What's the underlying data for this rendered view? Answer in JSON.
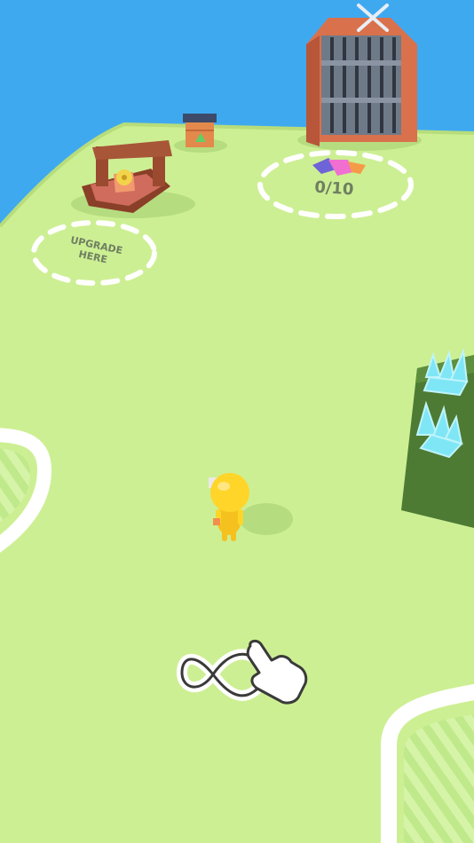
{
  "upgrade_zone": {
    "label_line1": "UPGRADE",
    "label_line2": "HERE"
  },
  "gate_zone": {
    "progress_text": "0/10",
    "collected": 0,
    "required": 10
  },
  "colors": {
    "sky": "#3fa9f0",
    "ground": "#cdef93",
    "ground_edge": "#b7dd7b",
    "player": "#ffd52a",
    "gate_wood": "#d9714c",
    "crystal": "#7fe6f6",
    "zone_dash": "#ffffff"
  },
  "icons": {
    "gem": "gem-icon",
    "tutorial": "swipe-infinity-hand-icon",
    "gate_emblem": "crossed-swords-icon"
  }
}
